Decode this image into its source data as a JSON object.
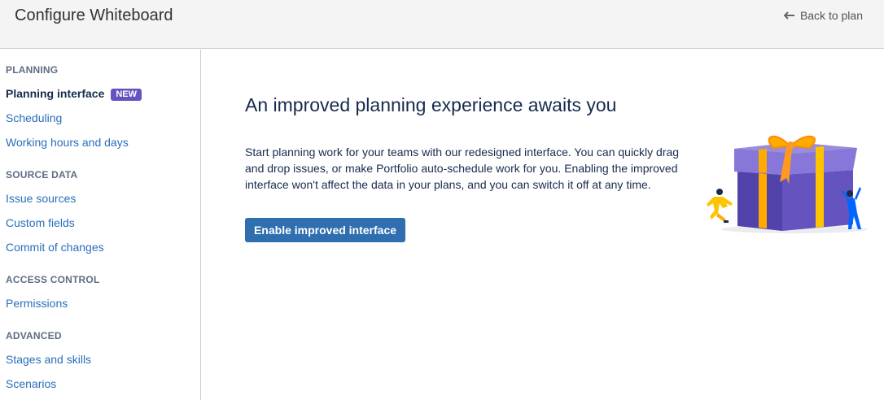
{
  "header": {
    "title": "Configure Whiteboard",
    "back_label": "Back to plan"
  },
  "sidebar": {
    "sections": [
      {
        "heading": "PLANNING",
        "items": [
          {
            "label": "Planning interface",
            "badge": "NEW",
            "active": true
          },
          {
            "label": "Scheduling"
          },
          {
            "label": "Working hours and days"
          }
        ]
      },
      {
        "heading": "SOURCE DATA",
        "items": [
          {
            "label": "Issue sources"
          },
          {
            "label": "Custom fields"
          },
          {
            "label": "Commit of changes"
          }
        ]
      },
      {
        "heading": "ACCESS CONTROL",
        "items": [
          {
            "label": "Permissions"
          }
        ]
      },
      {
        "heading": "ADVANCED",
        "items": [
          {
            "label": "Stages and skills"
          },
          {
            "label": "Scenarios"
          }
        ]
      }
    ]
  },
  "main": {
    "heading": "An improved planning experience awaits you",
    "description": "Start planning work for your teams with our redesigned interface. You can quickly drag and drop issues, or make Portfolio auto-schedule work for you. Enabling the improved interface won't affect the data in your plans, and you can switch it off at any time.",
    "button_label": "Enable improved interface"
  },
  "colors": {
    "link": "#2a6ebb",
    "badge": "#6554c0",
    "button": "#2f6fb0",
    "gift_box": "#6a5acd",
    "ribbon": "#ffab00"
  },
  "icons": {
    "back": "arrow-left-icon",
    "illustration": "gift-box-illustration"
  }
}
